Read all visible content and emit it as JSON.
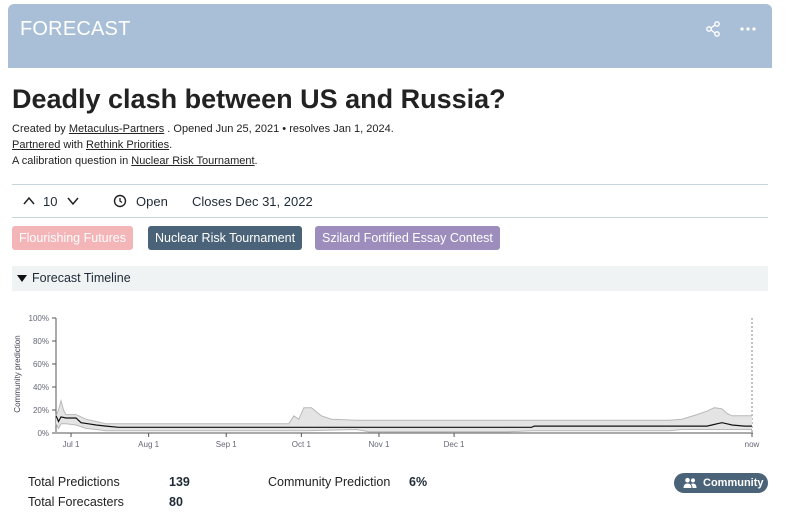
{
  "header": {
    "title": "FORECAST"
  },
  "question": {
    "title": "Deadly clash between US and Russia?",
    "created_by_prefix": "Created by ",
    "author": "Metaculus-Partners",
    "opened_resolves": " . Opened Jun 25, 2021 • resolves Jan 1, 2024.",
    "partnered": "Partnered",
    "partnered_with": " with ",
    "partner": "Rethink Priorities",
    "partner_suffix": ".",
    "calibration_prefix": "A calibration question in ",
    "tournament_link": "Nuclear Risk Tournament",
    "calibration_suffix": "."
  },
  "bar": {
    "votes": "10",
    "status": "Open",
    "closes": "Closes Dec 31, 2022"
  },
  "tags": [
    "Flourishing Futures",
    "Nuclear Risk Tournament",
    "Szilard Fortified Essay Contest"
  ],
  "timeline": {
    "label": "Forecast Timeline"
  },
  "chart_data": {
    "type": "line",
    "ylabel": "Community prediction",
    "y_ticks": [
      "100%",
      "80%",
      "60%",
      "40%",
      "20%",
      "0%"
    ],
    "x_ticks": [
      "Jul 1",
      "Aug 1",
      "Sep 1",
      "Oct 1",
      "Nov 1",
      "Dec 1",
      "now"
    ],
    "ylim": [
      0,
      100
    ],
    "grid": false,
    "series": [
      {
        "role": "median",
        "points": [
          [
            0,
            15
          ],
          [
            1,
            10
          ],
          [
            2,
            14
          ],
          [
            4,
            13
          ],
          [
            8,
            13
          ],
          [
            10,
            9
          ],
          [
            13,
            8
          ],
          [
            16,
            7
          ],
          [
            20,
            6
          ],
          [
            25,
            5
          ],
          [
            35,
            5
          ],
          [
            60,
            5
          ],
          [
            65,
            5
          ],
          [
            66,
            5
          ],
          [
            70,
            5
          ],
          [
            95,
            5
          ],
          [
            125,
            5
          ],
          [
            160,
            5
          ],
          [
            180,
            5
          ],
          [
            190,
            5
          ],
          [
            191,
            6
          ],
          [
            196,
            6
          ],
          [
            200,
            6
          ],
          [
            220,
            6
          ],
          [
            240,
            6
          ],
          [
            250,
            6
          ],
          [
            255,
            6
          ],
          [
            260,
            6
          ],
          [
            262,
            7
          ],
          [
            264,
            8
          ],
          [
            266,
            9
          ],
          [
            268,
            8
          ],
          [
            270,
            7
          ],
          [
            275,
            6
          ],
          [
            278,
            6
          ]
        ]
      },
      {
        "role": "upper",
        "points": [
          [
            0,
            15
          ],
          [
            1,
            20
          ],
          [
            2,
            28
          ],
          [
            3,
            20
          ],
          [
            4,
            16
          ],
          [
            8,
            16
          ],
          [
            12,
            12
          ],
          [
            16,
            10
          ],
          [
            20,
            8
          ],
          [
            30,
            8
          ],
          [
            60,
            8
          ],
          [
            70,
            8
          ],
          [
            93,
            8
          ],
          [
            95,
            15
          ],
          [
            97,
            12
          ],
          [
            99,
            22
          ],
          [
            102,
            22
          ],
          [
            106,
            15
          ],
          [
            110,
            12
          ],
          [
            120,
            11
          ],
          [
            140,
            11
          ],
          [
            160,
            11
          ],
          [
            190,
            11
          ],
          [
            210,
            11
          ],
          [
            230,
            11
          ],
          [
            245,
            11
          ],
          [
            250,
            12
          ],
          [
            256,
            16
          ],
          [
            260,
            19
          ],
          [
            263,
            22
          ],
          [
            266,
            21
          ],
          [
            268,
            17
          ],
          [
            270,
            15
          ],
          [
            278,
            15
          ]
        ]
      },
      {
        "role": "lower",
        "points": [
          [
            0,
            8
          ],
          [
            1,
            4
          ],
          [
            2,
            8
          ],
          [
            4,
            8
          ],
          [
            8,
            7
          ],
          [
            12,
            4
          ],
          [
            16,
            3
          ],
          [
            20,
            2
          ],
          [
            30,
            2
          ],
          [
            60,
            2
          ],
          [
            70,
            2
          ],
          [
            95,
            2
          ],
          [
            100,
            2
          ],
          [
            120,
            3
          ],
          [
            125,
            1
          ],
          [
            130,
            1
          ],
          [
            150,
            1
          ],
          [
            180,
            1
          ],
          [
            190,
            2
          ],
          [
            200,
            2
          ],
          [
            230,
            2
          ],
          [
            245,
            2
          ],
          [
            250,
            3
          ],
          [
            255,
            3
          ],
          [
            260,
            3
          ],
          [
            268,
            3
          ],
          [
            278,
            3
          ]
        ]
      }
    ]
  },
  "stats": {
    "total_predictions_label": "Total Predictions",
    "total_predictions": "139",
    "total_forecasters_label": "Total Forecasters",
    "total_forecasters": "80",
    "community_prediction_label": "Community Prediction",
    "community_prediction": "6%",
    "community_button": "Community"
  },
  "colors": {
    "header_bg": "#a9bfd8",
    "tag_flourishing": "#f3b5b8",
    "tag_nuclear": "#4b6378",
    "tag_szilard": "#9c8dbd",
    "community_button": "#4b6378"
  },
  "icons": [
    "share-icon",
    "more-icon",
    "chevron-up-icon",
    "chevron-down-icon",
    "clock-icon",
    "caret-down-icon",
    "people-icon"
  ]
}
